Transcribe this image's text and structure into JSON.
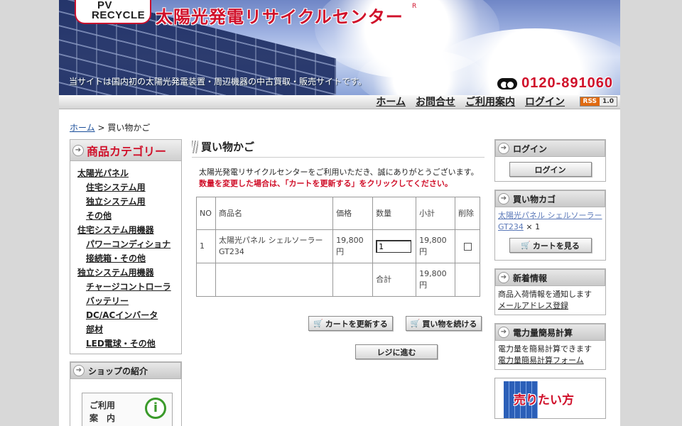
{
  "header": {
    "logo_text_line1": "PV",
    "logo_text_line2": "RECYCLE",
    "site_title": "太陽光発電リサイクルセンター",
    "registered_mark": "R",
    "tagline": "当サイトは国内初の太陽光発電装置・周辺機器の中古買取・販売サイトです。",
    "phone": "0120-891060"
  },
  "nav": {
    "home": "ホーム",
    "contact": "お問合せ",
    "guide": "ご利用案内",
    "login": "ログイン",
    "rss_label": "RSS",
    "rss_version": "1.0"
  },
  "breadcrumb": {
    "home": "ホーム",
    "separator": ">",
    "current": "買い物かご"
  },
  "left": {
    "category_title": "商品カテゴリー",
    "categories": [
      {
        "label": "太陽光パネル",
        "level": 0
      },
      {
        "label": "住宅システム用",
        "level": 1
      },
      {
        "label": "独立システム用",
        "level": 1
      },
      {
        "label": "その他",
        "level": 1
      },
      {
        "label": "住宅システム用機器",
        "level": 0
      },
      {
        "label": "パワーコンディショナ",
        "level": 1
      },
      {
        "label": "接続箱・その他",
        "level": 1
      },
      {
        "label": "独立システム用機器",
        "level": 0
      },
      {
        "label": "チャージコントローラ",
        "level": 1
      },
      {
        "label": "バッテリー",
        "level": 1
      },
      {
        "label": "DC/ACインバータ",
        "level": 1
      },
      {
        "label": "部材",
        "level": 1
      },
      {
        "label": "LED電球・その他",
        "level": 1
      }
    ],
    "shop_title": "ショップの紹介",
    "shop_banner_line1": "ご利用",
    "shop_banner_line2": "案　内"
  },
  "main": {
    "title": "買い物かご",
    "intro": "太陽光発電リサイクルセンターをご利用いただき、誠にありがとうございます。",
    "warning": "数量を変更した場合は、「カートを更新する」をクリックしてください。",
    "table": {
      "headers": [
        "NO",
        "商品名",
        "価格",
        "数量",
        "小計",
        "削除"
      ],
      "rows": [
        {
          "no": "1",
          "name": "太陽光パネル シェルソーラー GT234",
          "price": "19,800円",
          "qty": "1",
          "subtotal": "19,800円"
        }
      ],
      "total_label": "合計",
      "total_value": "19,800円"
    },
    "buttons": {
      "update_cart": "カートを更新する",
      "continue_shopping": "買い物を続ける",
      "checkout": "レジに進む"
    }
  },
  "right": {
    "login_title": "ログイン",
    "login_button": "ログイン",
    "cart_title": "買い物カゴ",
    "cart_item": "太陽光パネル シェルソーラー GT234",
    "cart_qty": "× 1",
    "cart_button": "カートを見る",
    "news_title": "新着情報",
    "news_text": "商品入荷情報を通知します",
    "news_link": "メールアドレス登録",
    "calc_title": "電力量簡易計算",
    "calc_text": "電力量を簡易計算できます",
    "calc_link": "電力量簡易計算フォーム",
    "sell_banner": "売りたい方"
  },
  "colors": {
    "accent_red": "#d0102a",
    "link_blue": "#1a4e9a"
  }
}
